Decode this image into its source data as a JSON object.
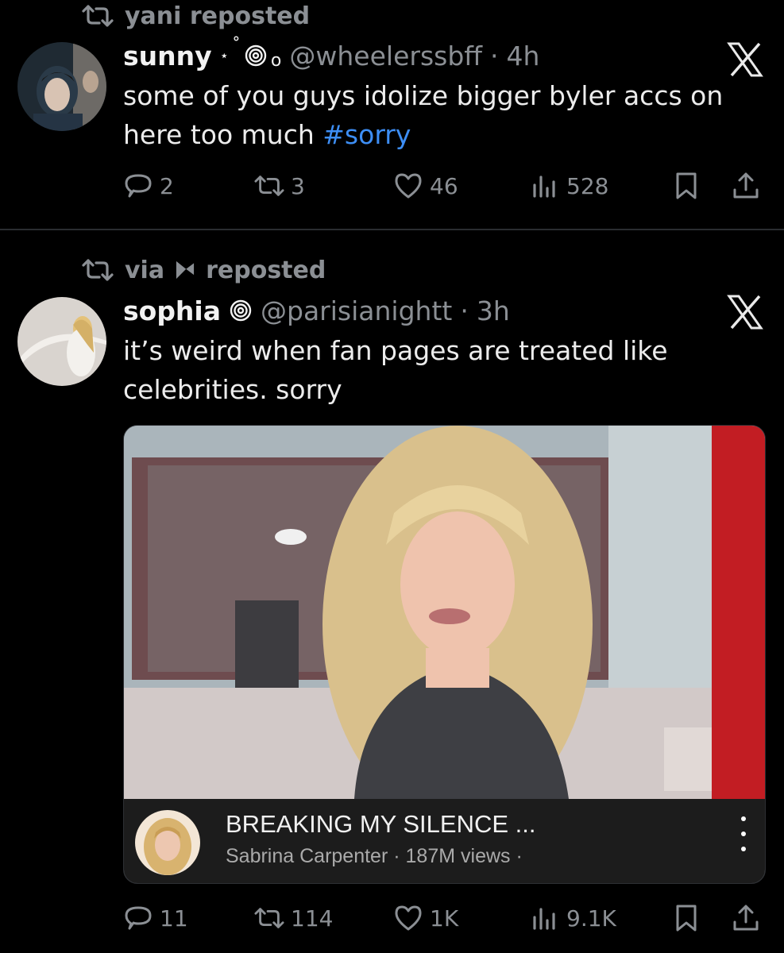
{
  "posts": [
    {
      "reposted_by": "yani reposted",
      "author": {
        "name": "sunny",
        "decoration": "⋆˚🌀₀",
        "handle": "@wheelerssbff",
        "separator": "·",
        "time": "4h"
      },
      "text": "some of you guys idolize bigger byler accs on here too much ",
      "hashtag": "#sorry",
      "stats": {
        "replies": "2",
        "reposts": "3",
        "likes": "46",
        "views": "528"
      }
    },
    {
      "reposted_by_prefix": "via",
      "reposted_by_suffix": "reposted",
      "author": {
        "name": "sophia",
        "handle": "@parisianightt",
        "separator": "·",
        "time": "3h"
      },
      "text": "it’s weird when fan pages are treated like celebrities. sorry",
      "media": {
        "video_title": "BREAKING MY SILENCE ...",
        "channel": "Sabrina Carpenter",
        "views": "187M views"
      },
      "stats": {
        "replies": "11",
        "reposts": "114",
        "likes": "1K",
        "views": "9.1K"
      }
    }
  ],
  "colors": {
    "background": "#000000",
    "muted": "#8b8f94",
    "link": "#3d8ef5"
  },
  "icons": [
    "repost-icon",
    "reply-icon",
    "like-icon",
    "views-icon",
    "bookmark-icon",
    "share-icon",
    "x-logo-icon",
    "spiral-icon",
    "more-icon"
  ]
}
